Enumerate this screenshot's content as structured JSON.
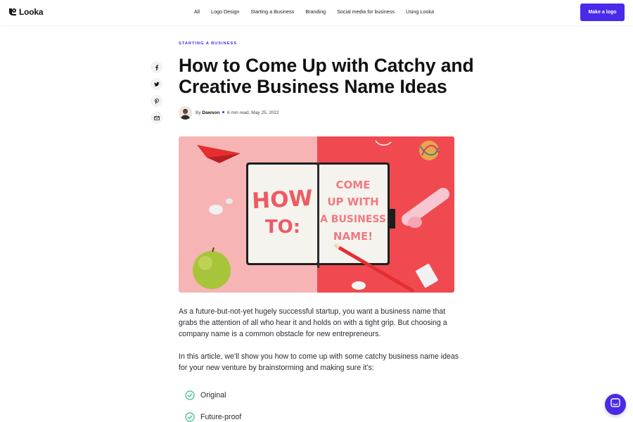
{
  "brand": {
    "name": "Looka",
    "accent": "#4a2ae8"
  },
  "nav": {
    "items": [
      "All",
      "Logo Design",
      "Starting a Business",
      "Branding",
      "Social media for business",
      "Using Looka"
    ],
    "cta_label": "Make a logo"
  },
  "share": {
    "icons": [
      "facebook-icon",
      "twitter-icon",
      "pinterest-icon",
      "email-icon"
    ]
  },
  "article": {
    "category": "STARTING A BUSINESS",
    "title": "How to Come Up with Catchy and Creative Business Name Ideas",
    "byline_prefix": "By",
    "author": "Dawson",
    "meta": "6 min read, May 25, 2022",
    "hero": {
      "left_text": [
        "HOW",
        "TO:"
      ],
      "right_text": [
        "COME",
        "UP WITH",
        "A BUSINESS",
        "NAME!"
      ]
    },
    "paragraphs": [
      "As a future-but-not-yet hugely successful startup, you want a business name that grabs the attention of all who hear it and holds on with a tight grip. But choosing a company name is a common obstacle for new entrepreneurs.",
      "In this article, we’ll show you how to come up with some catchy business name ideas for your new venture by brainstorming and making sure it’s:"
    ],
    "checklist": [
      "Original",
      "Future-proof"
    ]
  },
  "chat": {
    "icon": "chat-icon"
  }
}
